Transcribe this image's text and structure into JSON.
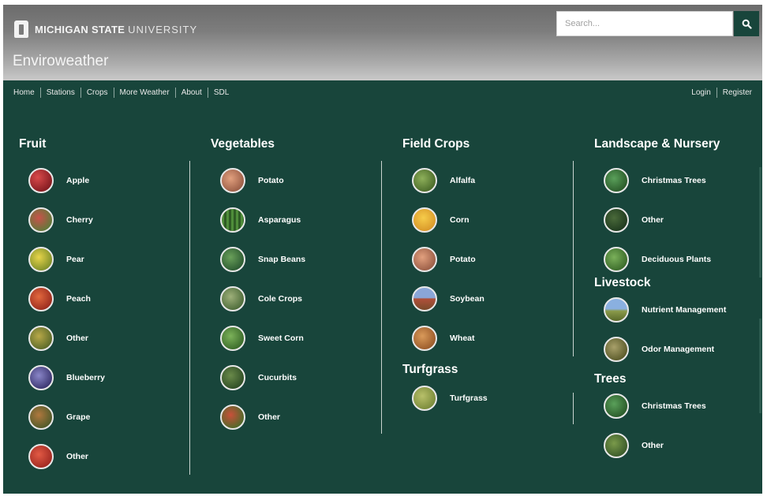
{
  "header": {
    "logo_bold": "MICHIGAN STATE",
    "logo_light": "UNIVERSITY",
    "app_name": "Enviroweather",
    "search_placeholder": "Search...",
    "search_icon": "search-icon"
  },
  "nav": {
    "left": [
      "Home",
      "Stations",
      "Crops",
      "More Weather",
      "About",
      "SDL"
    ],
    "right": [
      "Login",
      "Register"
    ]
  },
  "colors": {
    "brand_green": "#18453b",
    "header_gray": "#8a8a8a"
  },
  "sections": {
    "fruit": {
      "title": "Fruit",
      "items": [
        "Apple",
        "Cherry",
        "Pear",
        "Peach",
        "Other",
        "Blueberry",
        "Grape",
        "Other"
      ]
    },
    "vegetables": {
      "title": "Vegetables",
      "items": [
        "Potato",
        "Asparagus",
        "Snap Beans",
        "Cole Crops",
        "Sweet Corn",
        "Cucurbits",
        "Other"
      ]
    },
    "field_crops": {
      "title": "Field Crops",
      "items": [
        "Alfalfa",
        "Corn",
        "Potato",
        "Soybean",
        "Wheat"
      ]
    },
    "turfgrass": {
      "title": "Turfgrass",
      "items": [
        "Turfgrass"
      ]
    },
    "landscape": {
      "title": "Landscape & Nursery",
      "items": [
        "Christmas Trees",
        "Other",
        "Deciduous Plants"
      ]
    },
    "livestock": {
      "title": "Livestock",
      "items": [
        "Nutrient Management",
        "Odor Management"
      ]
    },
    "trees": {
      "title": "Trees",
      "items": [
        "Christmas Trees",
        "Other"
      ]
    }
  }
}
